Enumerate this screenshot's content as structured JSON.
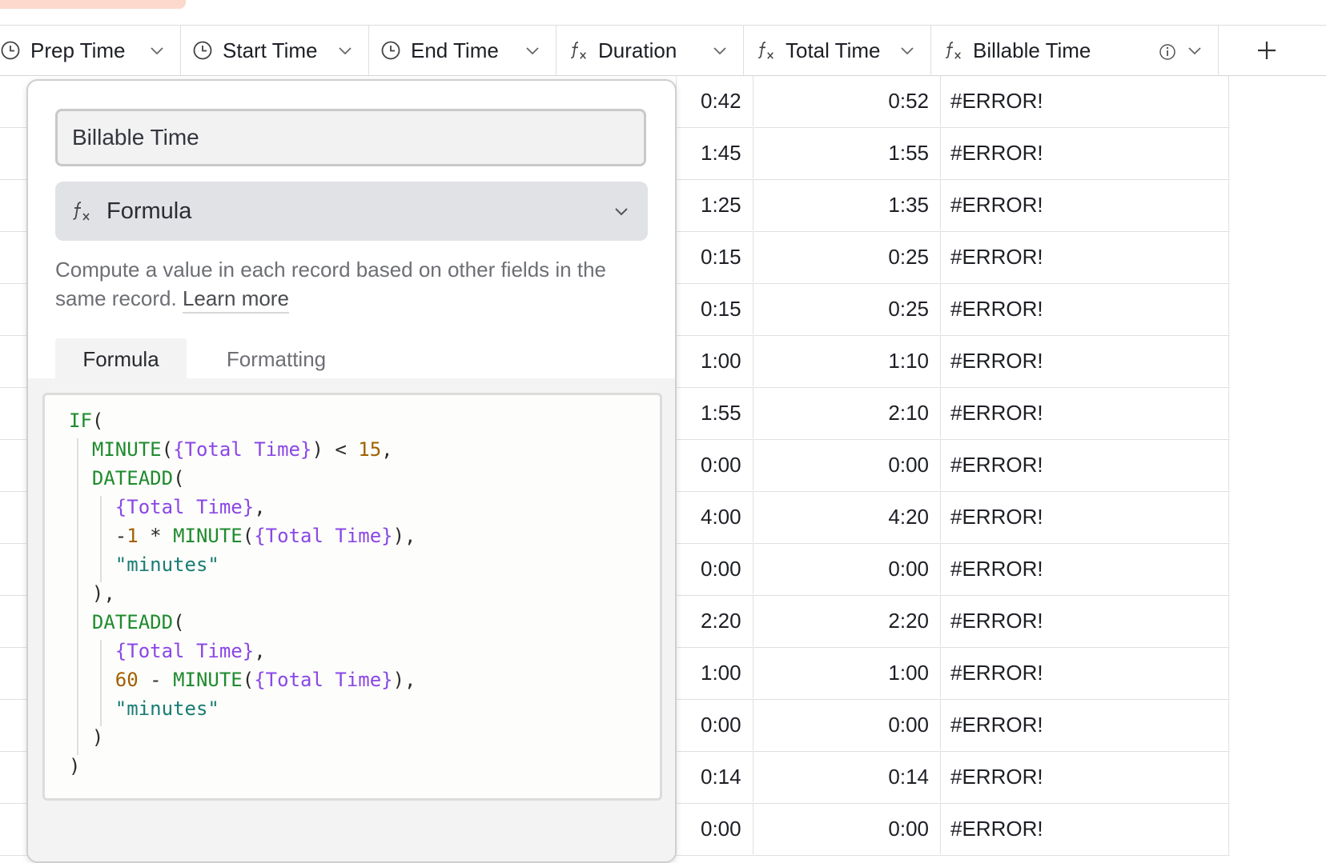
{
  "columns": [
    {
      "name": "col-prep-time",
      "label": "Prep Time",
      "icon": "clock-icon",
      "width": 240
    },
    {
      "name": "col-start-time",
      "label": "Start Time",
      "icon": "clock-icon",
      "width": 235
    },
    {
      "name": "col-end-time",
      "label": "End Time",
      "icon": "clock-icon",
      "width": 234
    },
    {
      "name": "col-duration",
      "label": "Duration",
      "icon": "formula-icon",
      "width": 234
    },
    {
      "name": "col-total-time",
      "label": "Total Time",
      "icon": "formula-icon",
      "width": 234
    },
    {
      "name": "col-billable-time",
      "label": "Billable Time",
      "icon": "formula-icon",
      "width": 359
    }
  ],
  "add_column_icon": "plus-icon",
  "rows": [
    {
      "duration": "0:42",
      "total": "0:52",
      "billable": "#ERROR!"
    },
    {
      "duration": "1:45",
      "total": "1:55",
      "billable": "#ERROR!"
    },
    {
      "duration": "1:25",
      "total": "1:35",
      "billable": "#ERROR!"
    },
    {
      "duration": "0:15",
      "total": "0:25",
      "billable": "#ERROR!"
    },
    {
      "duration": "0:15",
      "total": "0:25",
      "billable": "#ERROR!"
    },
    {
      "duration": "1:00",
      "total": "1:10",
      "billable": "#ERROR!"
    },
    {
      "duration": "1:55",
      "total": "2:10",
      "billable": "#ERROR!"
    },
    {
      "duration": "0:00",
      "total": "0:00",
      "billable": "#ERROR!"
    },
    {
      "duration": "4:00",
      "total": "4:20",
      "billable": "#ERROR!"
    },
    {
      "duration": "0:00",
      "total": "0:00",
      "billable": "#ERROR!"
    },
    {
      "duration": "2:20",
      "total": "2:20",
      "billable": "#ERROR!"
    },
    {
      "duration": "1:00",
      "total": "1:00",
      "billable": "#ERROR!"
    },
    {
      "duration": "0:00",
      "total": "0:00",
      "billable": "#ERROR!"
    },
    {
      "duration": "0:14",
      "total": "0:14",
      "billable": "#ERROR!"
    },
    {
      "duration": "0:00",
      "total": "0:00",
      "billable": "#ERROR!"
    }
  ],
  "panel": {
    "field_name": "Billable Time",
    "field_type": "Formula",
    "description": "Compute a value in each record based on other fields in the same record.",
    "learn_more": "Learn more",
    "tabs": [
      "Formula",
      "Formatting"
    ],
    "active_tab": "Formula",
    "formula_lines": [
      [
        {
          "t": "IF",
          "c": "fn"
        },
        {
          "t": "(",
          "c": "pun"
        }
      ],
      [
        {
          "t": "  "
        },
        {
          "t": "MINUTE",
          "c": "fn"
        },
        {
          "t": "(",
          "c": "pun"
        },
        {
          "t": "{Total Time}",
          "c": "fld"
        },
        {
          "t": ") < ",
          "c": "pun"
        },
        {
          "t": "15",
          "c": "num"
        },
        {
          "t": ",",
          "c": "pun"
        }
      ],
      [
        {
          "t": "  "
        },
        {
          "t": "DATEADD",
          "c": "fn"
        },
        {
          "t": "(",
          "c": "pun"
        }
      ],
      [
        {
          "t": "    "
        },
        {
          "t": "{Total Time}",
          "c": "fld"
        },
        {
          "t": ",",
          "c": "pun"
        }
      ],
      [
        {
          "t": "    "
        },
        {
          "t": "-",
          "c": "pun"
        },
        {
          "t": "1",
          "c": "num"
        },
        {
          "t": " * ",
          "c": "pun"
        },
        {
          "t": "MINUTE",
          "c": "fn"
        },
        {
          "t": "(",
          "c": "pun"
        },
        {
          "t": "{Total Time}",
          "c": "fld"
        },
        {
          "t": "),",
          "c": "pun"
        }
      ],
      [
        {
          "t": "    "
        },
        {
          "t": "\"minutes\"",
          "c": "str"
        }
      ],
      [
        {
          "t": "  "
        },
        {
          "t": "),",
          "c": "pun"
        }
      ],
      [
        {
          "t": "  "
        },
        {
          "t": "DATEADD",
          "c": "fn"
        },
        {
          "t": "(",
          "c": "pun"
        }
      ],
      [
        {
          "t": "    "
        },
        {
          "t": "{Total Time}",
          "c": "fld"
        },
        {
          "t": ",",
          "c": "pun"
        }
      ],
      [
        {
          "t": "    "
        },
        {
          "t": "60",
          "c": "num"
        },
        {
          "t": " - ",
          "c": "pun"
        },
        {
          "t": "MINUTE",
          "c": "fn"
        },
        {
          "t": "(",
          "c": "pun"
        },
        {
          "t": "{Total Time}",
          "c": "fld"
        },
        {
          "t": "),",
          "c": "pun"
        }
      ],
      [
        {
          "t": "    "
        },
        {
          "t": "\"minutes\"",
          "c": "str"
        }
      ],
      [
        {
          "t": "  "
        },
        {
          "t": ")",
          "c": "pun"
        }
      ],
      [
        {
          "t": ")",
          "c": "pun"
        }
      ]
    ]
  }
}
